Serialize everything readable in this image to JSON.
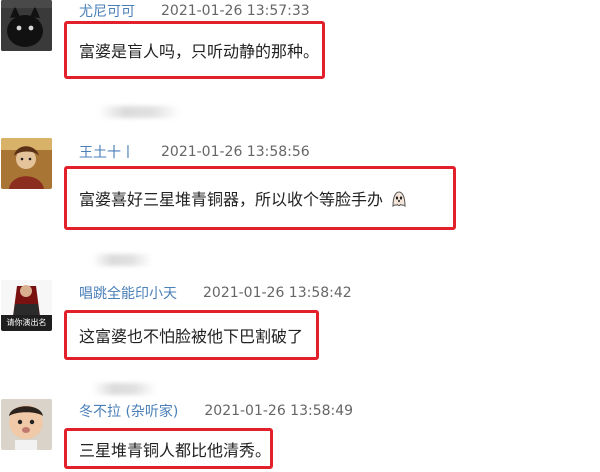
{
  "comments": [
    {
      "username": "尤尼可可",
      "timestamp": "2021-01-26 13:57:33",
      "text": "富婆是盲人吗，只听动静的那种。",
      "avatar_icon": "black-cat-avatar"
    },
    {
      "username": "王土十丨",
      "timestamp": "2021-01-26 13:58:56",
      "text": "富婆喜好三星堆青铜器，所以收个等脸手办",
      "emoji_icon": "ghost-emoji-icon",
      "avatar_icon": "painted-portrait-avatar"
    },
    {
      "username": "唱跳全能印小天",
      "timestamp": "2021-01-26 13:58:42",
      "text": "这富婆也不怕脸被他下巴割破了",
      "avatar_icon": "performer-avatar",
      "avatar_caption": "请你演出名"
    },
    {
      "username": "冬不拉 (杂听家)",
      "timestamp": "2021-01-26 13:58:49",
      "text": "三星堆青铜人都比他清秀。",
      "avatar_icon": "toddler-avatar"
    }
  ],
  "colors": {
    "highlight": "#e1202b",
    "username": "#4a7fb7",
    "timestamp": "#666666",
    "text": "#222222"
  }
}
